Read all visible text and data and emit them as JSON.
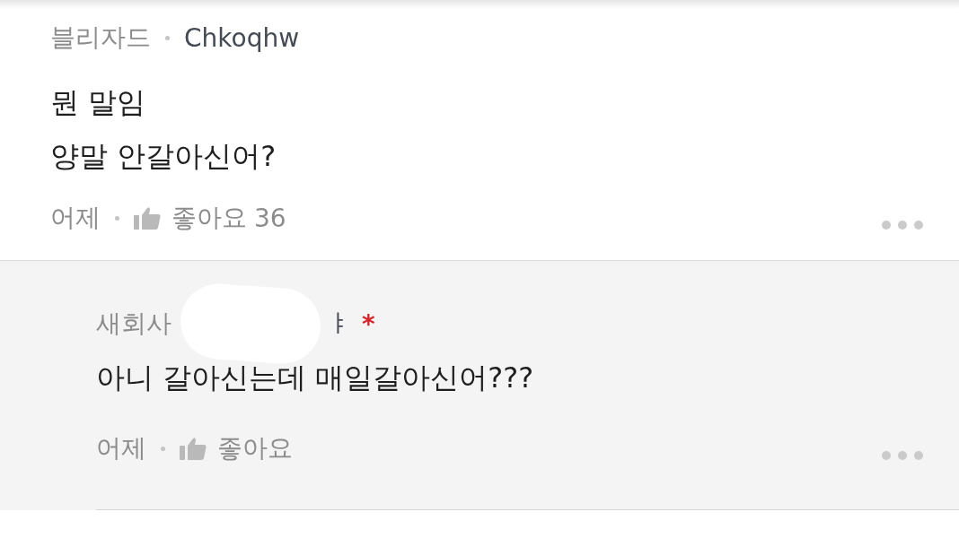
{
  "comments": [
    {
      "board": "블리자드",
      "nickname": "Chkoqhw",
      "redacted": false,
      "lines": [
        "뭔 말임",
        "양말 안갈아신어?"
      ],
      "time": "어제",
      "like_label": "좋아요",
      "like_count": "36",
      "reply": false
    },
    {
      "board": "새회사",
      "nickname": "ㅑ",
      "redacted": true,
      "badge": "*",
      "lines": [
        "아니 갈아신는데 매일갈아신어???"
      ],
      "time": "어제",
      "like_label": "좋아요",
      "reply": true
    }
  ]
}
